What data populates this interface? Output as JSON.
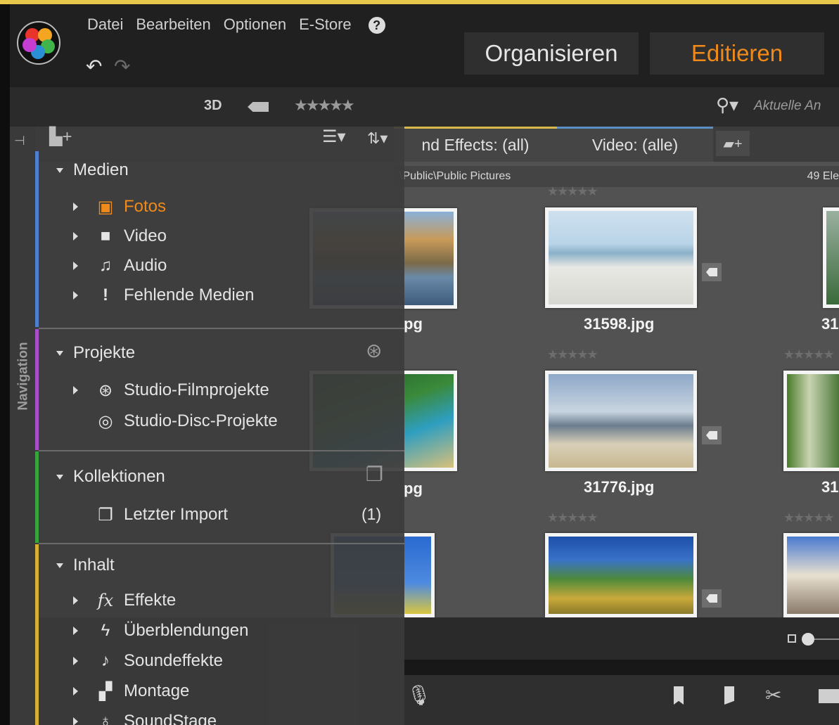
{
  "menu": {
    "datei": "Datei",
    "bearbeiten": "Bearbeiten",
    "optionen": "Optionen",
    "estore": "E-Store",
    "help": "?"
  },
  "modes": {
    "organize": "Organisieren",
    "edit": "Editieren"
  },
  "toolbar": {
    "view_3d": "3D",
    "rating_stars": "★★★★★",
    "search_placeholder": "Aktuelle An"
  },
  "tabs": [
    {
      "label": "nd Effects: (all)"
    },
    {
      "label": "Video: (alle)"
    }
  ],
  "pathbar": {
    "path": "\\Public\\Public Pictures",
    "count": "49 Ele"
  },
  "navigation": {
    "label": "Navigation",
    "sections": {
      "medien": {
        "label": "Medien",
        "items": [
          "Fotos",
          "Video",
          "Audio",
          "Fehlende Medien"
        ]
      },
      "projekte": {
        "label": "Projekte",
        "items": [
          "Studio-Filmprojekte",
          "Studio-Disc-Projekte"
        ]
      },
      "kollektionen": {
        "label": "Kollektionen",
        "items": [
          "Letzter Import"
        ],
        "count": "(1)"
      },
      "inhalt": {
        "label": "Inhalt",
        "items": [
          "Effekte",
          "Überblendungen",
          "Soundeffekte",
          "Montage",
          "SoundStage"
        ]
      }
    }
  },
  "thumbnails": {
    "left_caption_1": "pg",
    "left_caption_2": "pg",
    "center_caption_1": "31598.jpg",
    "center_caption_2": "31776.jpg",
    "right_caption_1": "31",
    "right_caption_2": "31",
    "stars": "★★★★★"
  },
  "colors": {
    "accent_orange": "#f08a1a",
    "medien_bar": "#4f7fd0",
    "projekte_bar": "#a64fc8",
    "kollektionen_bar": "#39a43d",
    "inhalt_bar": "#d5b132"
  }
}
